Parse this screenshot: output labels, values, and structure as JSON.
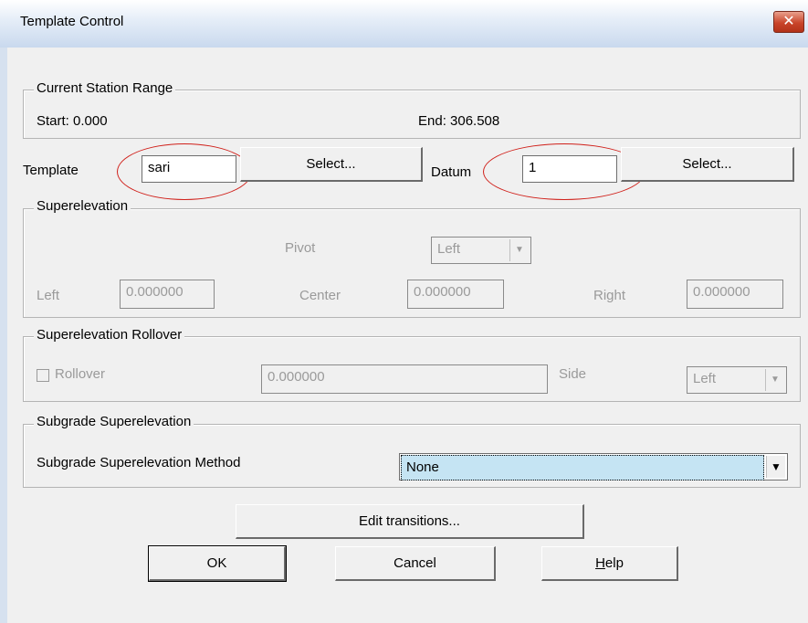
{
  "window": {
    "title": "Template Control",
    "close_glyph": "✕"
  },
  "station_range": {
    "group_label": "Current Station Range",
    "start": "Start: 0.000",
    "end": "End: 306.508"
  },
  "template": {
    "label": "Template",
    "value": "sari",
    "select_label": "Select..."
  },
  "datum": {
    "label": "Datum",
    "value": "1",
    "select_label": "Select..."
  },
  "superelevation": {
    "group_label": "Superelevation",
    "pivot_label": "Pivot",
    "pivot_value": "Left",
    "left_label": "Left",
    "left_value": "0.000000",
    "center_label": "Center",
    "center_value": "0.000000",
    "right_label": "Right",
    "right_value": "0.000000"
  },
  "rollover": {
    "group_label": "Superelevation Rollover",
    "checkbox_label": "Rollover",
    "value": "0.000000",
    "side_label": "Side",
    "side_value": "Left"
  },
  "subgrade": {
    "group_label": "Subgrade Superelevation",
    "method_label": "Subgrade Superelevation Method",
    "method_value": "None"
  },
  "buttons": {
    "edit_transitions": "Edit transitions...",
    "ok": "OK",
    "cancel": "Cancel",
    "help_prefix": "H",
    "help_rest": "elp"
  },
  "colors": {
    "annotation_circle": "#d0201a",
    "selection": "#c5e4f3"
  }
}
